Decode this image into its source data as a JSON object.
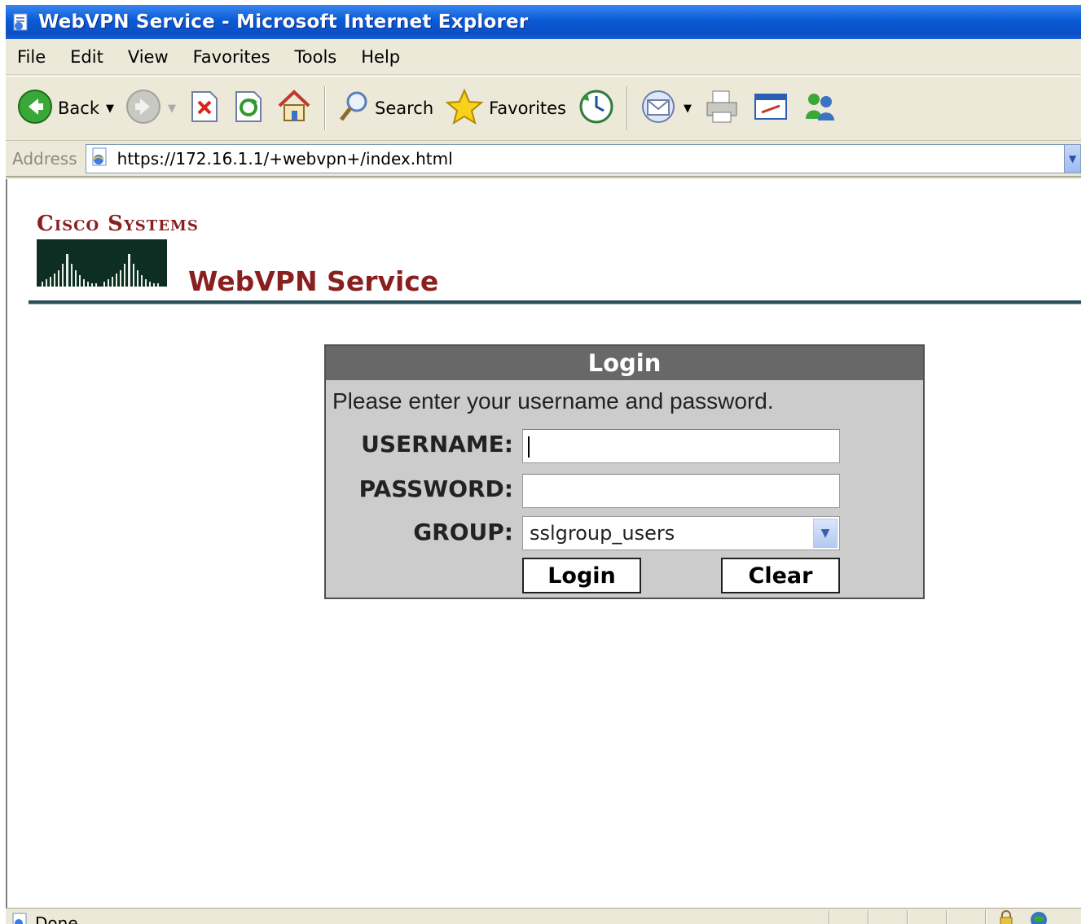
{
  "window": {
    "title": "WebVPN Service - Microsoft Internet Explorer"
  },
  "menu": {
    "items": [
      "File",
      "Edit",
      "View",
      "Favorites",
      "Tools",
      "Help"
    ]
  },
  "toolbar": {
    "back_label": "Back",
    "search_label": "Search",
    "favorites_label": "Favorites"
  },
  "address": {
    "label": "Address",
    "url": "https://172.16.1.1/+webvpn+/index.html"
  },
  "page": {
    "brand_text": "Cisco Systems",
    "heading": "WebVPN Service"
  },
  "login": {
    "title": "Login",
    "message": "Please enter your username and password.",
    "username_label": "USERNAME:",
    "username_value": "",
    "password_label": "PASSWORD:",
    "password_value": "",
    "group_label": "GROUP:",
    "group_value": "sslgroup_users",
    "login_button": "Login",
    "clear_button": "Clear"
  },
  "status": {
    "text": "Done"
  },
  "colors": {
    "brand": "#8a1f1f",
    "title_bar": "#0b4fc4",
    "login_header": "#686868",
    "login_panel": "#cccccc"
  }
}
